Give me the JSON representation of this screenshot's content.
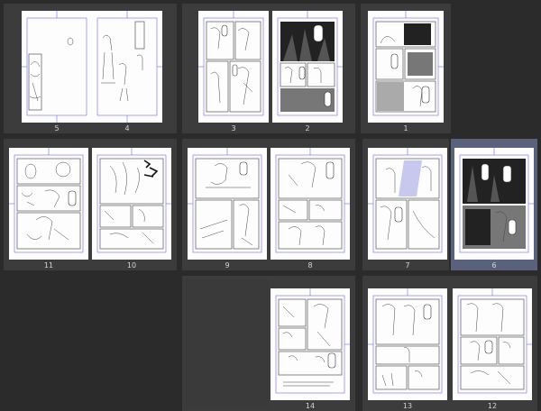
{
  "rows": [
    {
      "spreads": [
        {
          "pages": [
            {
              "number": "5",
              "style": "sketch-left"
            },
            {
              "number": "4",
              "style": "sketch-right"
            }
          ]
        },
        {
          "pages": [
            {
              "number": "3",
              "style": "pencil"
            },
            {
              "number": "2",
              "style": "inked"
            }
          ]
        },
        {
          "pages": [
            {
              "number": "1",
              "style": "inked"
            }
          ]
        }
      ]
    },
    {
      "spreads": [
        {
          "pages": [
            {
              "number": "11",
              "style": "pencil"
            },
            {
              "number": "10",
              "style": "pencil"
            }
          ]
        },
        {
          "pages": [
            {
              "number": "9",
              "style": "pencil"
            },
            {
              "number": "8",
              "style": "pencil"
            }
          ]
        },
        {
          "pages": [
            {
              "number": "7",
              "style": "pencil"
            },
            {
              "number": "6",
              "style": "dark",
              "selected": true
            }
          ]
        }
      ]
    },
    {
      "spreads": [
        {
          "pages": [
            {
              "number": "",
              "style": "empty"
            },
            {
              "number": "14",
              "style": "pencil"
            }
          ]
        },
        {
          "pages": [
            {
              "number": "13",
              "style": "pencil"
            },
            {
              "number": "12",
              "style": "pencil"
            }
          ]
        }
      ]
    }
  ],
  "colors": {
    "background": "#2b2b2b",
    "spread": "#3c3c3c",
    "selected": "#59627a",
    "guide": "#6a6af0"
  }
}
